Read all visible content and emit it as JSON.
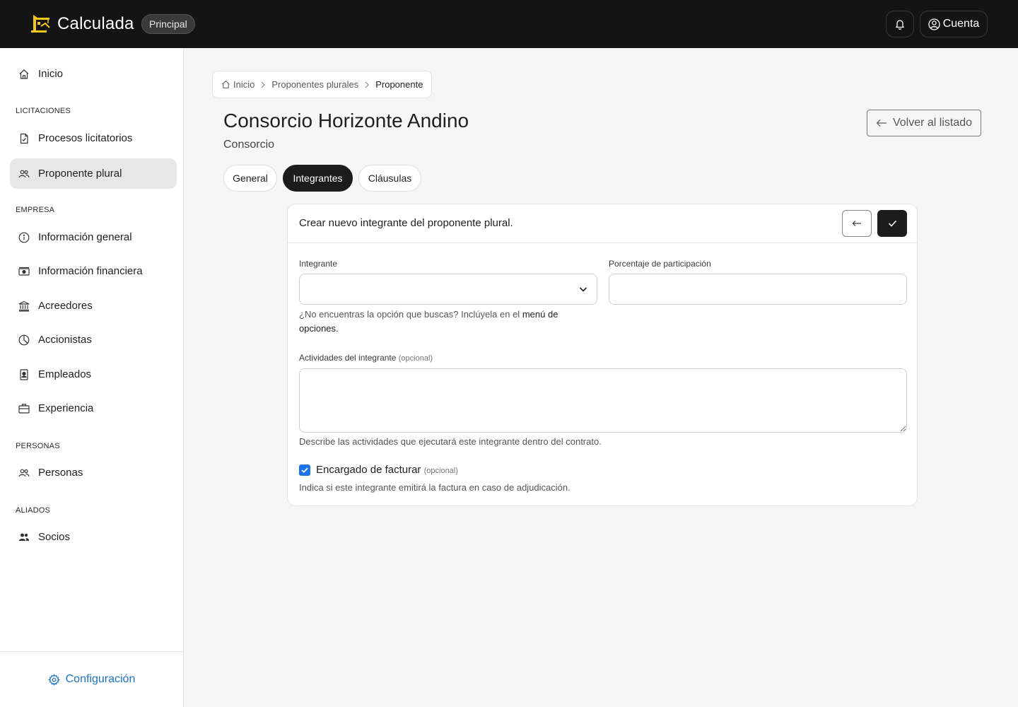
{
  "topbar": {
    "app_name": "Calculada",
    "env_badge": "Principal",
    "account_label": "Cuenta",
    "colors": {
      "background": "#141414",
      "logo": "#f5c518"
    }
  },
  "sidebar": {
    "home": {
      "label": "Inicio",
      "icon": "home-icon"
    },
    "sections": [
      {
        "title": "LICITACIONES",
        "items": [
          {
            "label": "Procesos licitatorios",
            "icon": "document-check-icon"
          },
          {
            "label": "Proponente plural",
            "icon": "users-icon",
            "active": true
          }
        ]
      },
      {
        "title": "EMPRESA",
        "items": [
          {
            "label": "Información general",
            "icon": "info-icon"
          },
          {
            "label": "Información financiera",
            "icon": "cash-icon"
          },
          {
            "label": "Acreedores",
            "icon": "bank-icon"
          },
          {
            "label": "Accionistas",
            "icon": "pie-chart-icon"
          },
          {
            "label": "Empleados",
            "icon": "id-badge-icon"
          },
          {
            "label": "Experiencia",
            "icon": "briefcase-icon"
          }
        ]
      },
      {
        "title": "PERSONAS",
        "items": [
          {
            "label": "Personas",
            "icon": "users-icon"
          }
        ]
      },
      {
        "title": "ALIADOS",
        "items": [
          {
            "label": "Socios",
            "icon": "users-solid-icon"
          }
        ]
      }
    ],
    "footer": {
      "label": "Configuración",
      "icon": "gear-icon",
      "color": "#1a73c6"
    }
  },
  "breadcrumb": {
    "items": [
      "Inicio",
      "Proponentes plurales",
      "Proponente"
    ]
  },
  "page": {
    "title": "Consorcio Horizonte Andino",
    "subtitle": "Consorcio",
    "back_button": "Volver al listado"
  },
  "tabs": [
    {
      "label": "General",
      "active": false
    },
    {
      "label": "Integrantes",
      "active": true
    },
    {
      "label": "Cláusulas",
      "active": false
    }
  ],
  "form": {
    "title": "Crear nuevo integrante del proponente plural.",
    "integrante": {
      "label": "Integrante",
      "value": "",
      "help_prefix": "¿No encuentras la opción que buscas? Inclúyela en el",
      "help_link": "menú de opciones."
    },
    "porcentaje": {
      "label": "Porcentaje de participación",
      "value": ""
    },
    "actividades": {
      "label": "Actividades del integrante",
      "optional": "(opcional)",
      "value": "",
      "help": "Describe las actividades que ejecutará este integrante dentro del contrato."
    },
    "facturar": {
      "label": "Encargado de facturar",
      "optional": "(opcional)",
      "checked": true,
      "help": "Indica si este integrante emitirá la factura en caso de adjudicación."
    }
  }
}
